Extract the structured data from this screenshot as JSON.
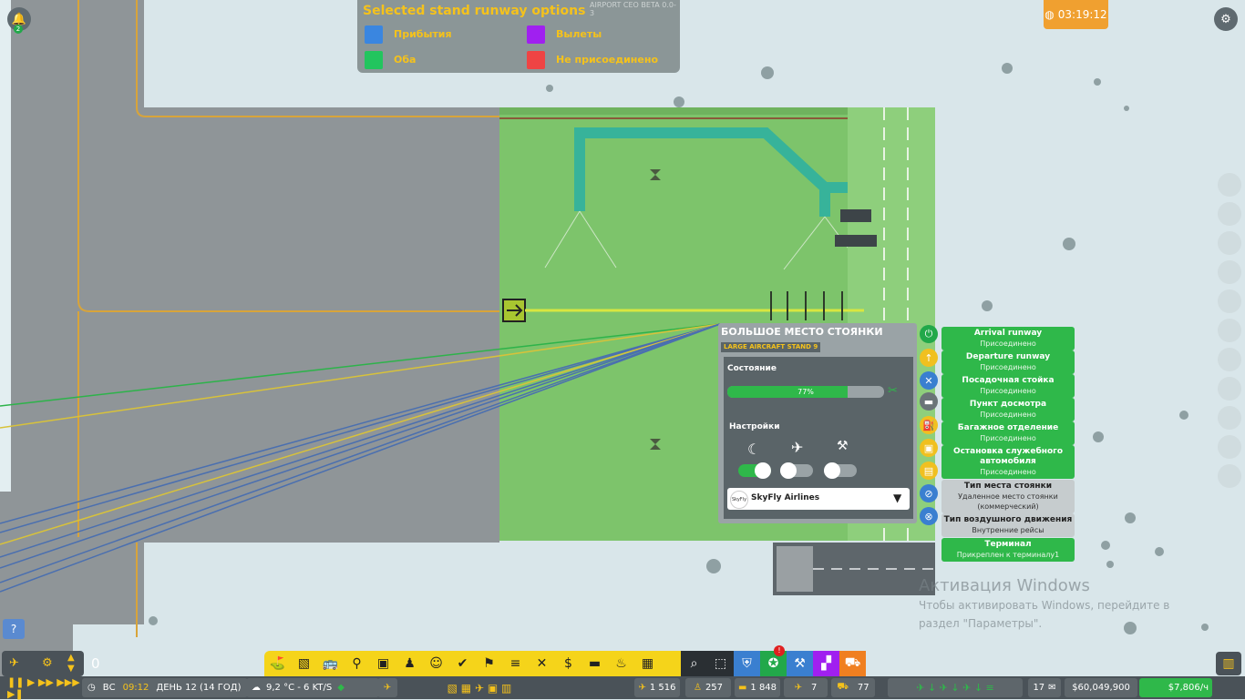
{
  "legend": {
    "title": "Selected stand runway options",
    "version": "AIRPORT CEO BETA 0.0-3",
    "items": [
      {
        "label": "Прибытия",
        "color": "#3a86e0"
      },
      {
        "label": "Вылеты",
        "color": "#a020f0"
      },
      {
        "label": "Оба",
        "color": "#22c55e"
      },
      {
        "label": "Не присоединено",
        "color": "#ef4444"
      }
    ]
  },
  "clock": {
    "time": "03:19:12",
    "icon": "globe-icon"
  },
  "notification": {
    "icon": "bell-icon",
    "badge": "2"
  },
  "top_right": {
    "icon": "gear-icon"
  },
  "stand_panel": {
    "title": "БОЛЬШОЕ МЕСТО СТОЯНКИ",
    "subtitle": "LARGE AIRCRAFT STAND 9",
    "state_label": "Состояние",
    "condition_text": "77%",
    "condition_value": 0.77,
    "settings_label": "Настройки",
    "toggles": [
      {
        "icon": "moon-icon",
        "on": true
      },
      {
        "icon": "airplane-icon",
        "on": false
      },
      {
        "icon": "worker-icon",
        "on": false
      }
    ],
    "airline": "SkyFly Airlines",
    "airline_logo": "SkyFly"
  },
  "side_icons": [
    {
      "icon": "power-icon",
      "color": "#22a84a"
    },
    {
      "icon": "arrow-up-icon",
      "color": "#f0c020"
    },
    {
      "icon": "wrench-icon",
      "color": "#3a7fd0"
    },
    {
      "icon": "vehicle-icon",
      "color": "#6a7478"
    },
    {
      "icon": "fuel-icon",
      "color": "#f0c020"
    },
    {
      "icon": "catering-icon",
      "color": "#f0c020"
    },
    {
      "icon": "baggage-icon",
      "color": "#f0c020"
    },
    {
      "icon": "no-baggage-icon",
      "color": "#3a7fd0"
    },
    {
      "icon": "cancel-icon",
      "color": "#3a7fd0"
    }
  ],
  "info_chips": [
    {
      "title": "Arrival runway",
      "value": "Присоединено",
      "kind": "green"
    },
    {
      "title": "Departure runway",
      "value": "Присоединено",
      "kind": "green"
    },
    {
      "title": "Посадочная стойка",
      "value": "Присоединено",
      "kind": "green"
    },
    {
      "title": "Пункт досмотра",
      "value": "Присоединено",
      "kind": "green"
    },
    {
      "title": "Багажное отделение",
      "value": "Присоединено",
      "kind": "green"
    },
    {
      "title": "Остановка служебного автомобиля",
      "value": "Присоединено",
      "kind": "green"
    },
    {
      "title": "Тип места стоянки",
      "value": "Удаленное место стоянки (коммерческий)",
      "kind": "grey"
    },
    {
      "title": "Тип воздушного движения",
      "value": "Внутренние рейсы",
      "kind": "grey"
    },
    {
      "title": "Терминал",
      "value": "Прикреплен к терминалу1",
      "kind": "green"
    }
  ],
  "watermark": {
    "title": "Активация Windows",
    "line1": "Чтобы активировать Windows, перейдите в",
    "line2": "раздел \"Параметры\"."
  },
  "help": "?",
  "left_tools": {
    "count": "0"
  },
  "toolbar": {
    "items": [
      "runway-icon",
      "stripes-icon",
      "bus-icon",
      "tower-icon",
      "suitcase-icon",
      "person-icon",
      "people-icon",
      "person-check-icon",
      "luggage-cart-icon",
      "conveyor-icon",
      "dining-icon",
      "money-icon",
      "bench-icon",
      "food-icon",
      "box-icon"
    ],
    "right_items": [
      {
        "icon": "search-icon",
        "color": "#2a2f33"
      },
      {
        "icon": "select-icon",
        "color": "#2a2f33"
      },
      {
        "icon": "security-icon",
        "color": "#3a7fd0"
      },
      {
        "icon": "stand-icon",
        "color": "#22a84a",
        "badge": "!"
      },
      {
        "icon": "build-icon",
        "color": "#3a7fd0"
      },
      {
        "icon": "zone-icon",
        "color": "#a020f0"
      },
      {
        "icon": "vehicles-icon",
        "color": "#f07f20"
      }
    ]
  },
  "bottom_bar": {
    "day_short": "ВС",
    "time": "09:12",
    "day": "ДЕНЬ 12 (14 ГОД)",
    "weather": "9,2 °C - 6 KT/S",
    "passengers": "1 516",
    "staff": "257",
    "flights": "1 848",
    "planes": "7",
    "vehicles": "77",
    "mail_count": "17",
    "money": "$60,049,900",
    "income": "$7,806/ч"
  },
  "chart_right": {
    "icon": "stats-icon"
  }
}
